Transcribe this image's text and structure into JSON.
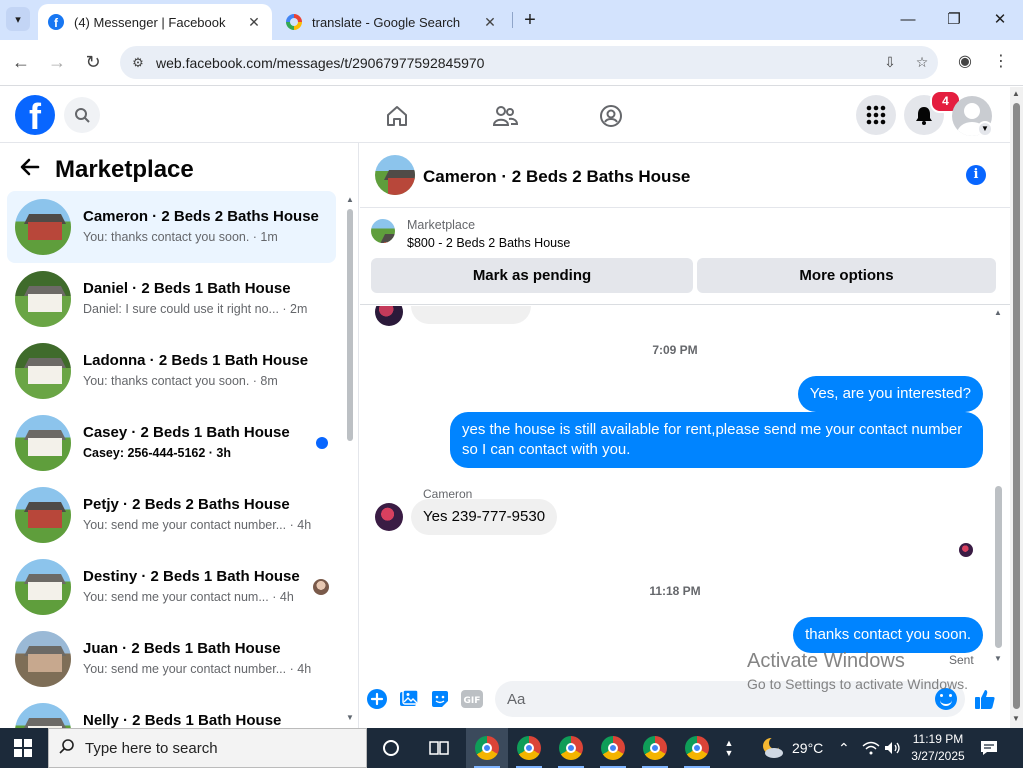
{
  "browser": {
    "tabs": [
      {
        "title": "(4) Messenger | Facebook",
        "active": true
      },
      {
        "title": "translate - Google Search",
        "active": false
      }
    ],
    "url": "web.facebook.com/messages/t/29067977592845970"
  },
  "facebook": {
    "notification_count": "4"
  },
  "left_panel": {
    "title": "Marketplace",
    "conversations": [
      {
        "name": "Cameron · 2 Beds 2 Baths House",
        "preview": "You: thanks contact you soon. · 1m",
        "active": true,
        "unread": false
      },
      {
        "name": "Daniel · 2 Beds 1 Bath House",
        "preview": "Daniel: I sure could use it right no...  · 2m",
        "active": false,
        "unread": false
      },
      {
        "name": "Ladonna · 2 Beds 1 Bath House",
        "preview": "You: thanks contact you soon. · 8m",
        "active": false,
        "unread": false
      },
      {
        "name": "Casey · 2 Beds 1 Bath House",
        "preview": "Casey: 256-444-5162 · 3h",
        "active": false,
        "unread": true
      },
      {
        "name": "Petjy · 2 Beds 2 Baths House",
        "preview": "You: send me your contact number...  · 4h",
        "active": false,
        "unread": false
      },
      {
        "name": "Destiny · 2 Beds 1 Bath House",
        "preview": "You: send me your contact num...  · 4h",
        "active": false,
        "unread": false
      },
      {
        "name": "Juan · 2 Beds 1 Bath House",
        "preview": "You: send me your contact number...  · 4h",
        "active": false,
        "unread": false
      },
      {
        "name": "Nelly · 2 Beds 1 Bath House",
        "preview": "",
        "active": false,
        "unread": false
      }
    ]
  },
  "chat": {
    "title": "Cameron · 2 Beds 2 Baths House",
    "listing_category": "Marketplace",
    "listing_item": "$800 - 2 Beds 2 Baths House",
    "mark_pending_label": "Mark as pending",
    "more_options_label": "More options",
    "time_1": "7:09 PM",
    "msg_out_1": "Yes, are you interested?",
    "msg_out_2_line1": "yes the house is still available for rent,please send me your contact number",
    "msg_out_2_line2": "so I can contact with you.",
    "sender_name": "Cameron",
    "msg_in_1": "Yes 239-777-9530",
    "time_2": "11:18 PM",
    "msg_out_3": "thanks contact you soon.",
    "status": "Sent",
    "composer_placeholder": "Aa"
  },
  "watermark": {
    "line1": "Activate Windows",
    "line2": "Go to Settings to activate Windows."
  },
  "taskbar": {
    "search_placeholder": "Type here to search",
    "weather": "29°C",
    "time": "11:19 PM",
    "date": "3/27/2025"
  },
  "colors": {
    "facebook_blue": "#0866ff",
    "messenger_bubble": "#0084ff",
    "notification_red": "#e41e3f",
    "active_row": "#ebf5ff"
  }
}
